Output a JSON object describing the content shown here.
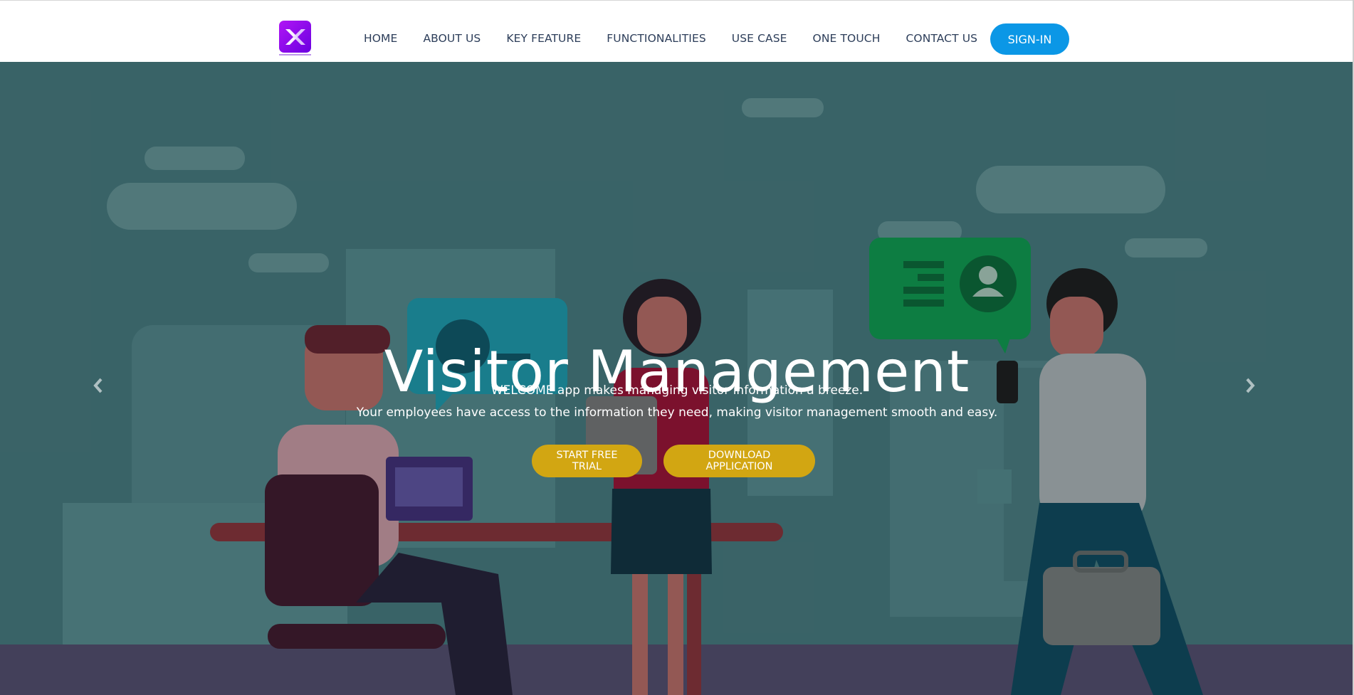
{
  "nav": {
    "logo_icon": "brand-logo-icon",
    "links": [
      {
        "label": "HOME"
      },
      {
        "label": "ABOUT US"
      },
      {
        "label": "KEY FEATURE"
      },
      {
        "label": "FUNCTIONALITIES"
      },
      {
        "label": "USE CASE"
      },
      {
        "label": "ONE TOUCH"
      },
      {
        "label": "CONTACT US"
      }
    ],
    "signin_label": "SIGN-IN"
  },
  "hero": {
    "title": "Visitor Management",
    "line1": "WELCOME app makes managing visitor information a breeze.",
    "line2": "Your employees have access to the information they need, making visitor management smooth and easy.",
    "trial_label": "START FREE TRIAL",
    "download_label": "DOWNLOAD APPLICATION",
    "prev_icon": "chevron-left-icon",
    "next_icon": "chevron-right-icon"
  },
  "colors": {
    "accent": "#0b97e6",
    "button_yellow": "#d2a612",
    "nav_text": "#2d3e5a",
    "hero_bg": "#3f6d70"
  }
}
